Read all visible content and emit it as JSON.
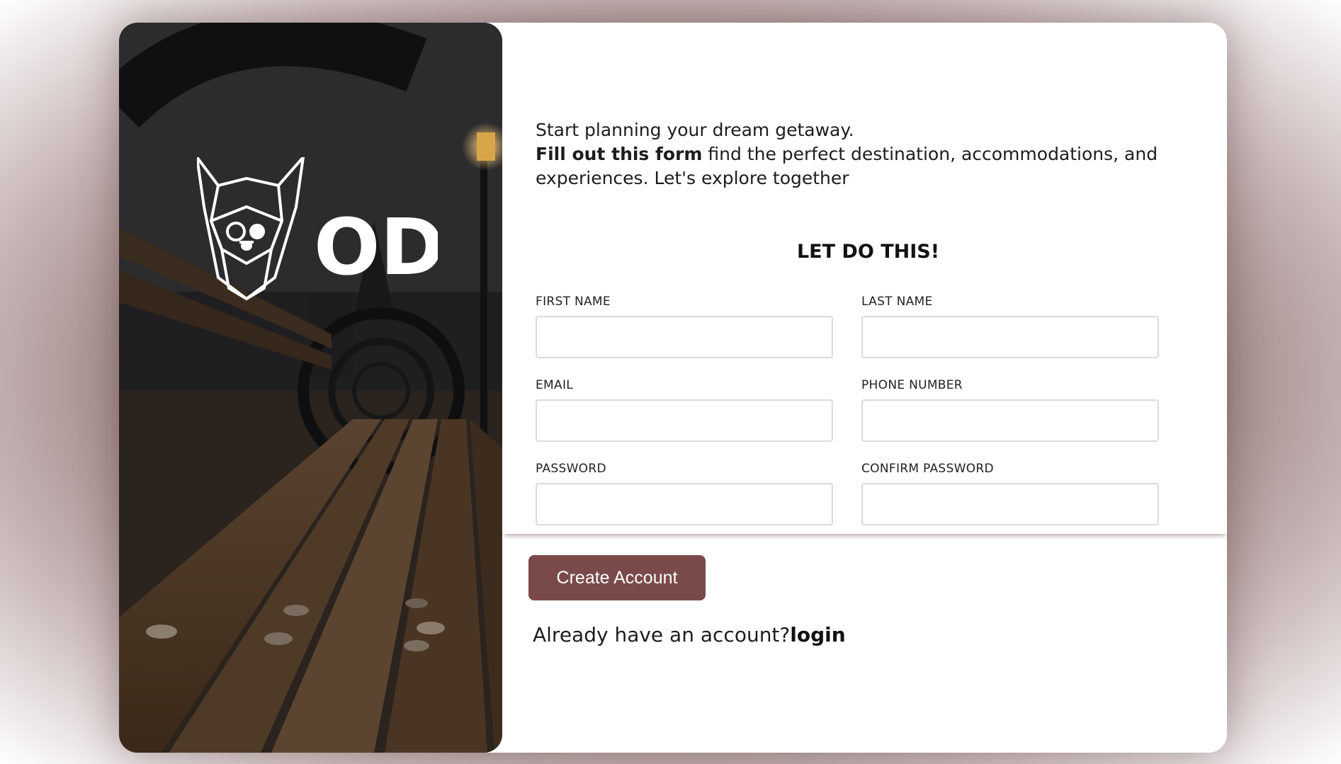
{
  "hero": {
    "logo_text": "ODIN"
  },
  "intro": {
    "line1": "Start planning your dream getaway.",
    "bold": "Fill out this form",
    "line2": " find the perfect destination, accommodations, and experiences. Let's explore together"
  },
  "form": {
    "title": "LET DO THIS!",
    "fields": [
      {
        "label": "FIRST NAME",
        "value": "",
        "placeholder": ""
      },
      {
        "label": "LAST NAME",
        "value": "",
        "placeholder": ""
      },
      {
        "label": "EMAIL",
        "value": "",
        "placeholder": ""
      },
      {
        "label": "PHONE NUMBER",
        "value": "",
        "placeholder": ""
      },
      {
        "label": "PASSWORD",
        "value": "",
        "placeholder": ""
      },
      {
        "label": "CONFIRM PASSWORD",
        "value": "",
        "placeholder": ""
      }
    ]
  },
  "actions": {
    "create_label": "Create Account",
    "login_prompt": "Already have an account?",
    "login_link": "login"
  },
  "colors": {
    "accent": "#7a4a4a",
    "background": "#8a6e6e"
  },
  "icons": {
    "logo": "viking-helmet-icon"
  }
}
